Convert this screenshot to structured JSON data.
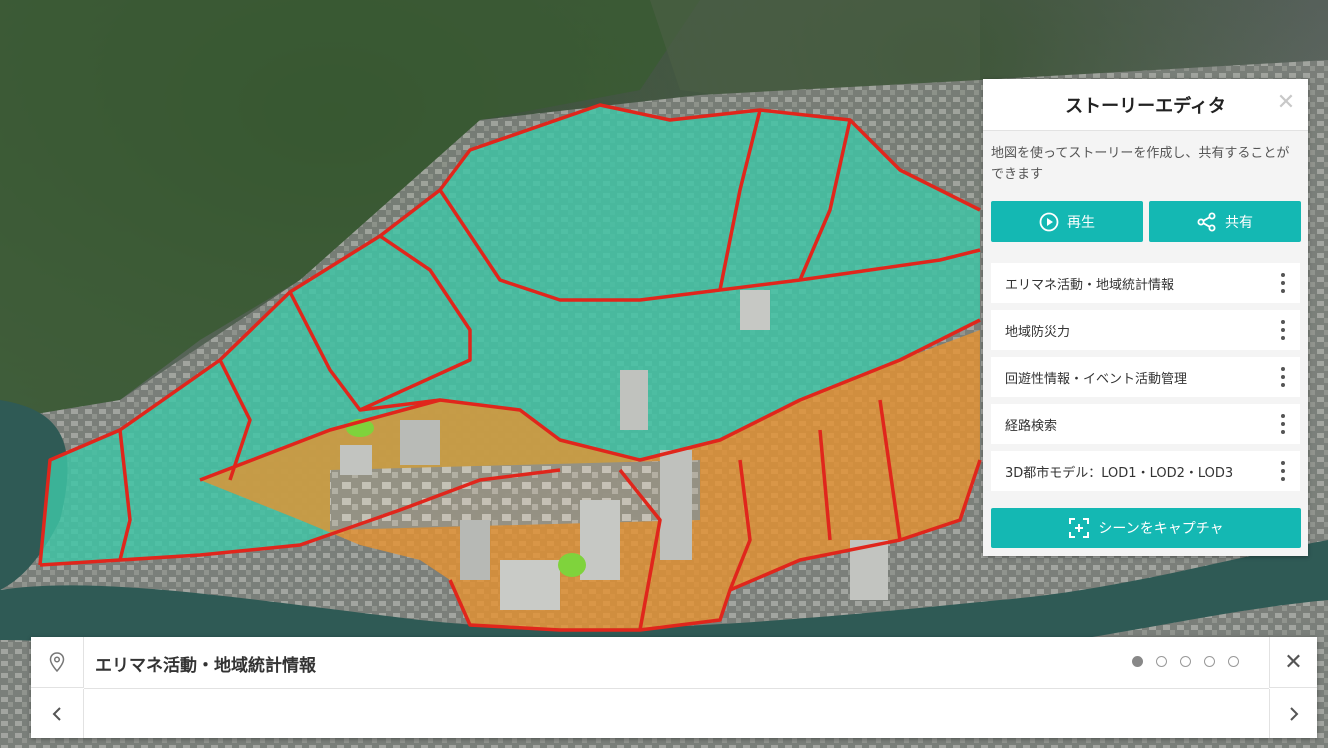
{
  "editor": {
    "title": "ストーリーエディタ",
    "description": "地図を使ってストーリーを作成し、共有することができます",
    "play_label": "再生",
    "share_label": "共有",
    "capture_label": "シーンをキャプチャ",
    "items": [
      {
        "label": "エリマネ活動・地域統計情報"
      },
      {
        "label": "地域防災力"
      },
      {
        "label": "回遊性情報・イベント活動管理"
      },
      {
        "label": "経路検索"
      },
      {
        "label": "3D都市モデル：LOD1・LOD2・LOD3"
      }
    ]
  },
  "storybar": {
    "title": "エリマネ活動・地域統計情報",
    "page_count": 5,
    "current_page": 1
  },
  "colors": {
    "accent": "#14b8b3",
    "boundary_red": "#e0261c",
    "zone_teal": "#3ec6a6",
    "zone_orange": "#e8922e"
  }
}
